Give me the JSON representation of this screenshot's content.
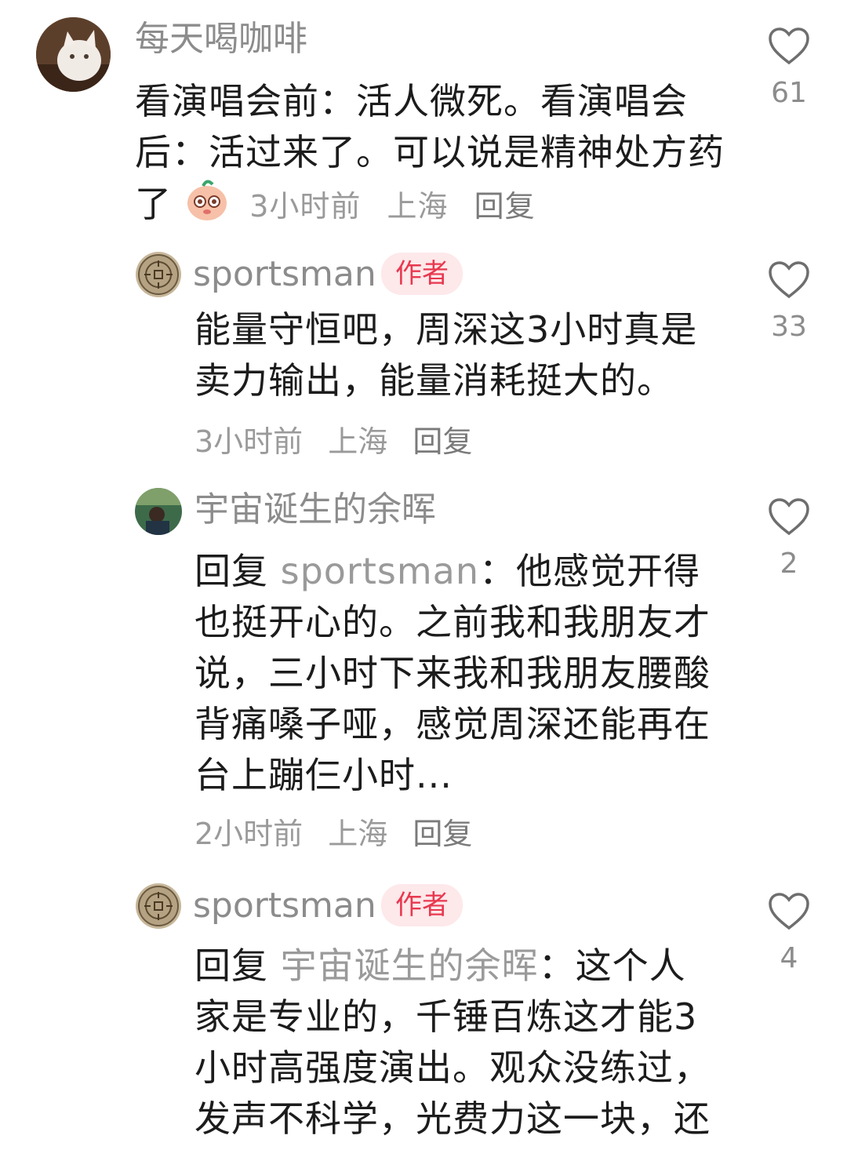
{
  "comments": [
    {
      "username": "每天喝咖啡",
      "text": "看演唱会前：活人微死。看演唱会后：活过来了。可以说是精神处方药了",
      "time": "3小时前",
      "location": "上海",
      "reply_label": "回复",
      "likes": "61"
    },
    {
      "username": "sportsman",
      "badge": "作者",
      "text": "能量守恒吧，周深这3小时真是卖力输出，能量消耗挺大的。",
      "time": "3小时前",
      "location": "上海",
      "reply_label": "回复",
      "likes": "33"
    },
    {
      "username": "宇宙诞生的余晖",
      "reply_prefix": "回复",
      "reply_to": "sportsman",
      "text": "：他感觉开得也挺开心的。之前我和我朋友才说，三小时下来我和我朋友腰酸背痛嗓子哑，感觉周深还能再在台上蹦仨小时...",
      "time": "2小时前",
      "location": "上海",
      "reply_label": "回复",
      "likes": "2"
    },
    {
      "username": "sportsman",
      "badge": "作者",
      "reply_prefix": "回复",
      "reply_to": "宇宙诞生的余晖",
      "text": "：这个人家是专业的，千锤百炼这才能3小时高强度演出。观众没练过，发声不科学，光费力这一块，还有连续三小时的体力",
      "likes": "4"
    }
  ]
}
